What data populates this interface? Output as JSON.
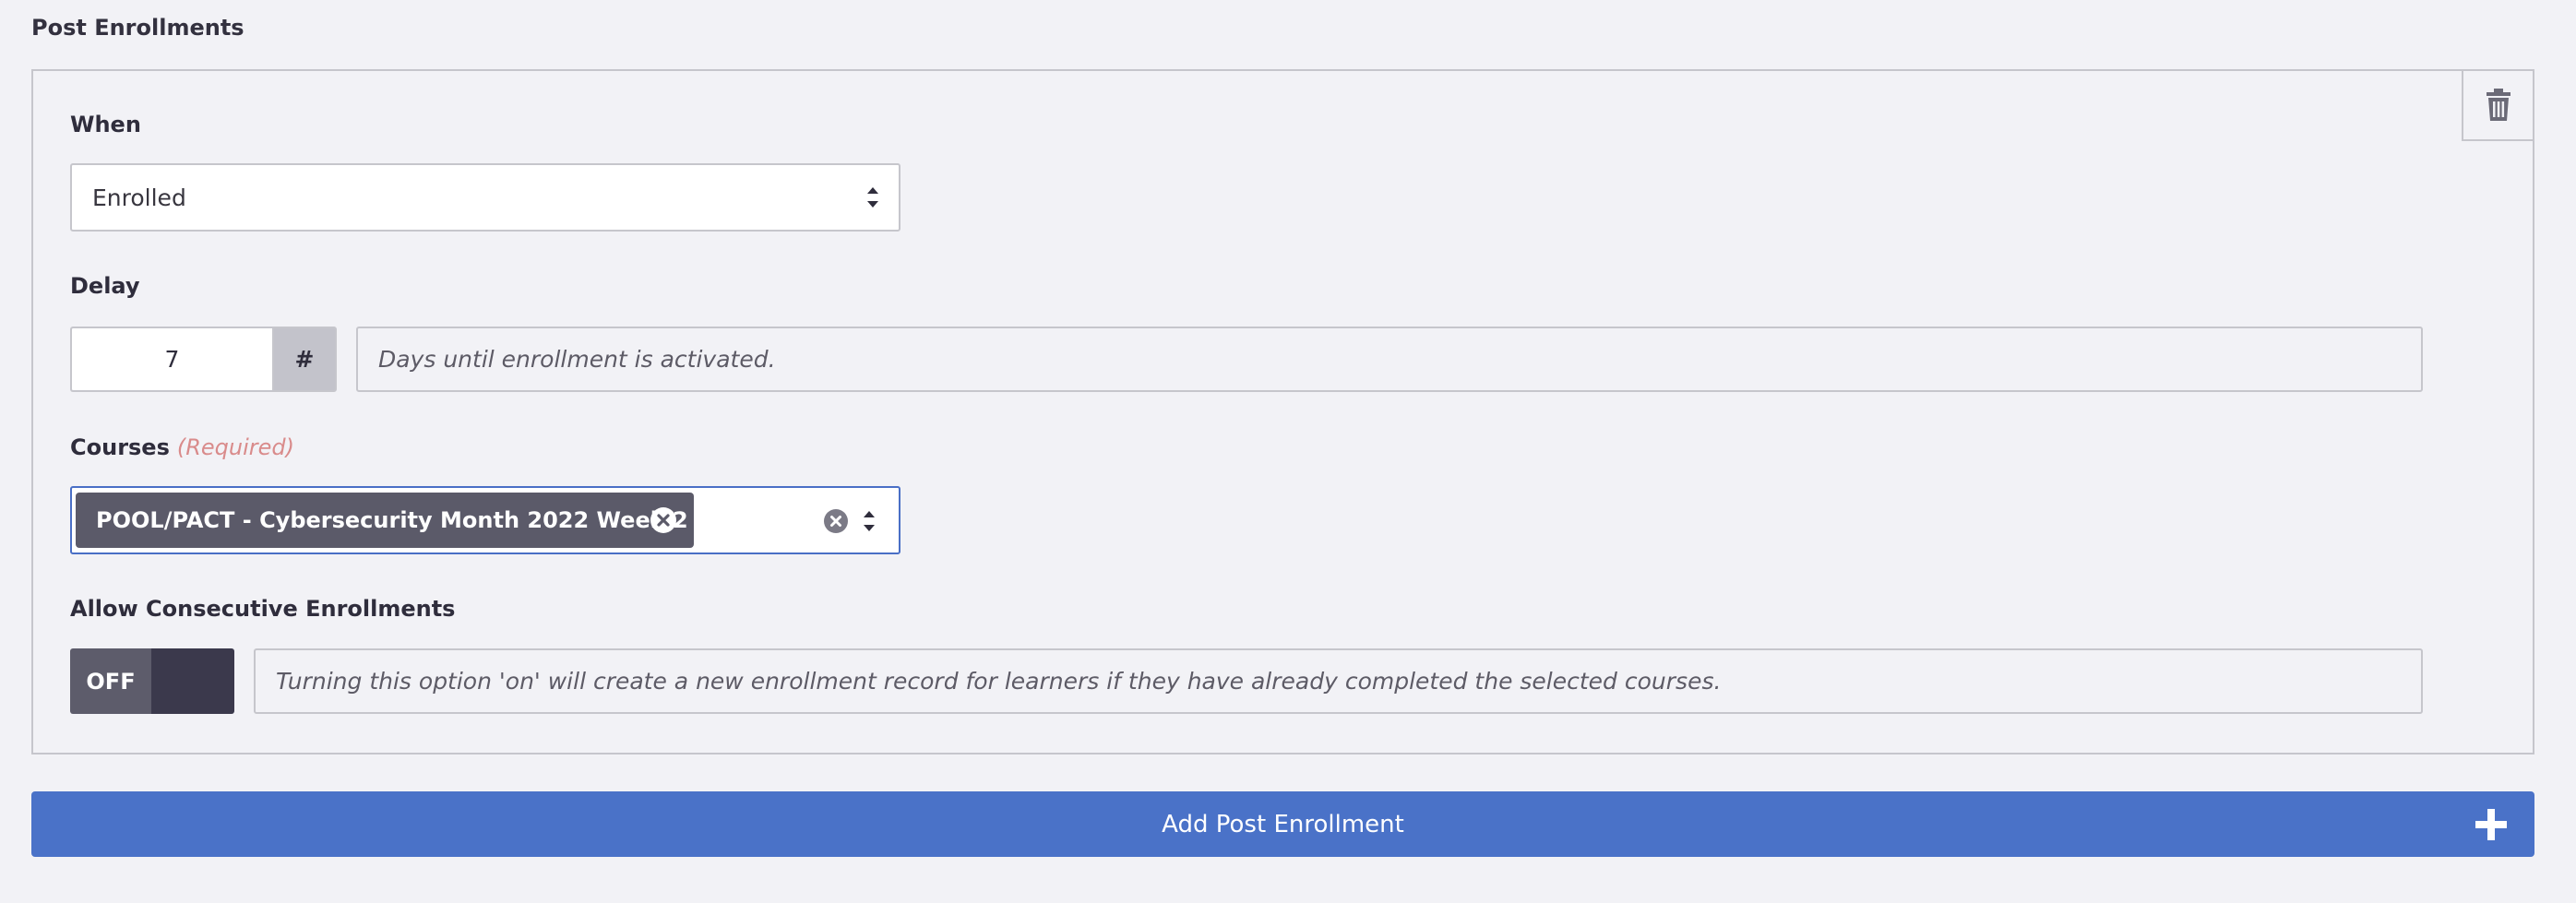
{
  "section_title": "Post Enrollments",
  "when": {
    "label": "When",
    "value": "Enrolled",
    "icon": "chevron-updown-icon"
  },
  "delay": {
    "label": "Delay",
    "value": "7",
    "addon": "#",
    "help": "Days until enrollment is activated."
  },
  "courses": {
    "label": "Courses",
    "required": "(Required)",
    "selected": [
      "POOL/PACT - Cybersecurity Month 2022 Week 2"
    ],
    "remove_icon": "circle-x-icon",
    "clear_icon": "circle-x-icon"
  },
  "consecutive": {
    "label": "Allow Consecutive Enrollments",
    "toggle_label": "OFF",
    "toggle_state": "off",
    "help": "Turning this option 'on' will create a new enrollment record for learners if they have already completed the selected courses."
  },
  "delete_icon": "trash-icon",
  "add_button": {
    "label": "Add Post Enrollment",
    "icon": "plus-icon"
  },
  "colors": {
    "accent": "#4a72c8",
    "focus_border": "#4a6fc6",
    "chip_bg": "#5b5a69",
    "required": "#d98b8b"
  }
}
